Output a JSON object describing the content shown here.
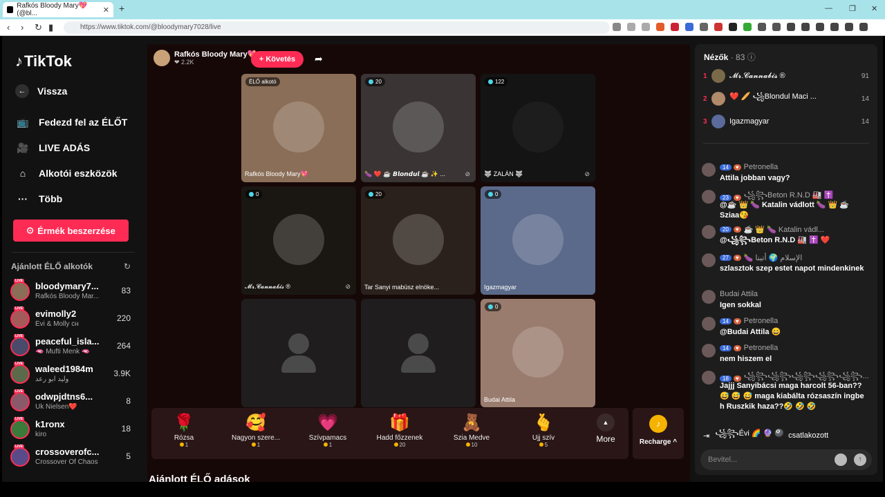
{
  "browser": {
    "tab_title": "Rafkós Bloody Mary💖 (@bl...",
    "tab_close": "✕",
    "new_tab": "+",
    "url": "https://www.tiktok.com/@bloodymary7028/live"
  },
  "sidebar": {
    "logo": "TikTok",
    "back": "Vissza",
    "nav": [
      "Fedezd fel az ÉLŐT",
      "LIVE ADÁS",
      "Alkotói eszközök",
      "Több"
    ],
    "coins_button": "Érmék beszerzése",
    "recommended_title": "Ajánlott ÉLŐ alkotók",
    "creators": [
      {
        "name": "bloodymary7...",
        "sub": "Rafkós Bloody Mar...",
        "count": "83"
      },
      {
        "name": "evimolly2",
        "sub": "Évi & Molly ᴄʜ",
        "count": "220"
      },
      {
        "name": "peaceful_isla...",
        "sub": "🫦 Mufti Menk 🫦",
        "count": "264"
      },
      {
        "name": "waleed1984m",
        "sub": "وليد ابو رعد",
        "count": "3.9K"
      },
      {
        "name": "odwpjdtns6...",
        "sub": "Uk Nielsen❤️",
        "count": "8"
      },
      {
        "name": "k1ronx",
        "sub": "kiro",
        "count": "18"
      },
      {
        "name": "crossoverofc...",
        "sub": "Crossover Of Chaos",
        "count": "5"
      }
    ],
    "live_tag": "LIVE"
  },
  "stage": {
    "host_name": "Rafkós Bloody Mary💖",
    "host_likes": "❤ 2.2K",
    "follow": "+ Követés",
    "tiles": [
      {
        "badge": "ÉLŐ alkotó",
        "name": "Rafkós Bloody Mary💖",
        "color": "#8a6e57"
      },
      {
        "badge": "20",
        "name": "🍆 ❤️ ☕ 𝘽𝙡𝙤𝙣𝙙𝙪𝙡 ☕ ✨ ...",
        "color": "#3a3434"
      },
      {
        "badge": "122",
        "name": "🐺 ZALÁN 🐺",
        "color": "#141414"
      },
      {
        "badge": "0",
        "name": "𝓜𝓻.𝓒𝓪𝓷𝓷𝓪𝓫𝓲𝓼 ®",
        "color": "#1a1712"
      },
      {
        "badge": "20",
        "name": "Tar Sanyi mabüsz elnöke...",
        "color": "#2b211c"
      },
      {
        "badge": "0",
        "name": "Igazmagyar",
        "color": "#5b6a8a"
      },
      {
        "badge": "",
        "name": "",
        "color": "#222"
      },
      {
        "badge": "",
        "name": "",
        "color": "#222"
      },
      {
        "badge": "0",
        "name": "Budai Attila",
        "color": "#9a7c6e"
      }
    ],
    "gifts": [
      {
        "icon": "🌹",
        "name": "Rózsa",
        "price": "1"
      },
      {
        "icon": "🥰",
        "name": "Nagyon szere...",
        "price": "1"
      },
      {
        "icon": "💗",
        "name": "Szívpamacs",
        "price": "1"
      },
      {
        "icon": "🎁",
        "name": "Hadd főzzenek",
        "price": "20"
      },
      {
        "icon": "🧸",
        "name": "Szia Medve",
        "price": "10"
      },
      {
        "icon": "🫰",
        "name": "Ujj szív",
        "price": "5"
      }
    ],
    "more": "More",
    "recharge": "Recharge ^",
    "section_title": "Ajánlott ÉLŐ adások"
  },
  "chat": {
    "viewers_label": "Nézők",
    "viewers_count": "· 83",
    "viewers": [
      {
        "rank": "1",
        "name": "𝓜𝓻.𝓒𝓪𝓷𝓷𝓪𝓫𝓲𝓼 ®",
        "score": "91"
      },
      {
        "rank": "2",
        "name": "❤️ 🥖 ꧁Blondul Maci ...",
        "score": "14"
      },
      {
        "rank": "3",
        "name": "Igazmagyar",
        "score": "14"
      }
    ],
    "messages": [
      {
        "lvl": "14",
        "user": "Petronella",
        "text": "Attila jobban vagy?"
      },
      {
        "lvl": "23",
        "user": "꧁꧂Beton R.N.D 🏭 ✝️",
        "text": "@☕ 👑 🍆 Katalin vádlott 🍆 👑 ☕ Sziaa😘"
      },
      {
        "lvl": "20",
        "user": "☕ 👑 🍆 Katalin vádl...",
        "text": "@꧁꧂Beton R.N.D 🏭 ✝️ ❤️"
      },
      {
        "lvl": "27",
        "user": "🍆 الإسلام 🌍 أتينا",
        "text": "szlasztok szep estet napot mindenkinek"
      },
      {
        "lvl": "",
        "user": "Budai Attila",
        "text": "Igen sokkal"
      },
      {
        "lvl": "14",
        "user": "Petronella",
        "text": "@Budai Attila 😄"
      },
      {
        "lvl": "14",
        "user": "Petronella",
        "text": "nem hiszem el"
      },
      {
        "lvl": "18",
        "user": "꧁꧂꧁꧂꧁꧂꧁꧂꧁꧂...",
        "text": "Jajjj Sanyibácsi maga harcolt 56-ban??😅 😅 😅 maga kiabálta rózsaszín ingbe h Ruszkik haza??🤣 🤣 🤣"
      }
    ],
    "joined_user": "꧁꧂Évi 🌈 🔮 🎱",
    "joined_text": "csatlakozott",
    "input_placeholder": "Bevitel..."
  }
}
